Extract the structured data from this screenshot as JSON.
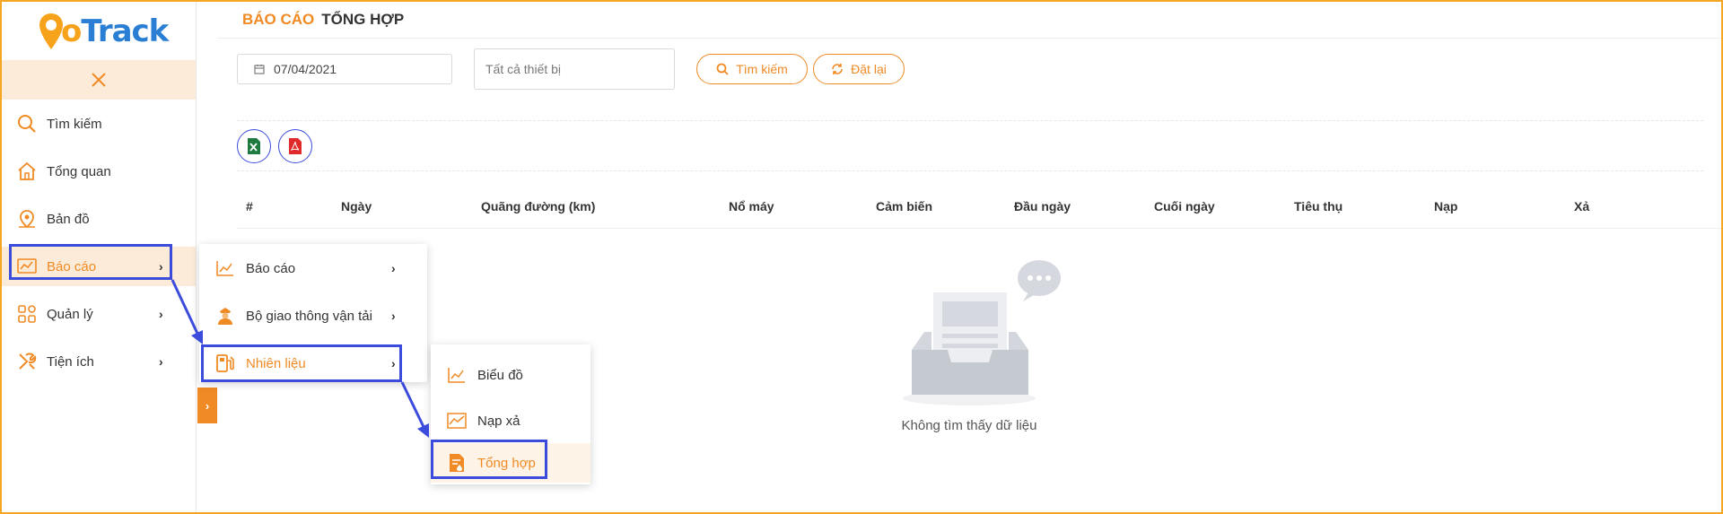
{
  "app": {
    "logo_g": "G",
    "logo_o": "o",
    "logo_rest": "Track"
  },
  "sidebar": {
    "close_icon": "close-icon",
    "items": [
      {
        "label": "Tìm kiếm",
        "icon": "search-icon"
      },
      {
        "label": "Tổng quan",
        "icon": "home-icon"
      },
      {
        "label": "Bản đồ",
        "icon": "map-pin-icon"
      },
      {
        "label": "Báo cáo",
        "icon": "chart-icon",
        "active": true
      },
      {
        "label": "Quản lý",
        "icon": "grid-icon"
      },
      {
        "label": "Tiện ích",
        "icon": "tools-icon"
      }
    ]
  },
  "breadcrumb": {
    "section": "BÁO CÁO",
    "page": "TỔNG HỢP"
  },
  "filters": {
    "date_value": "07/04/2021",
    "device_placeholder": "Tất cả thiết bị",
    "search_label": "Tìm kiếm",
    "reset_label": "Đặt lại"
  },
  "table": {
    "columns": [
      "#",
      "Ngày",
      "Quãng đường (km)",
      "Nổ máy",
      "Cảm biến",
      "Đầu ngày",
      "Cuối ngày",
      "Tiêu thụ",
      "Nạp",
      "Xả"
    ]
  },
  "empty_message": "Không tìm thấy dữ liệu",
  "submenu_1": {
    "items": [
      {
        "label": "Báo cáo",
        "icon": "line-chart-icon"
      },
      {
        "label": "Bộ giao thông vận tải",
        "icon": "officer-icon"
      },
      {
        "label": "Nhiên liệu",
        "icon": "fuel-pump-icon",
        "active": true
      }
    ]
  },
  "submenu_2": {
    "items": [
      {
        "label": "Biểu đồ",
        "icon": "line-chart-icon"
      },
      {
        "label": "Nạp xả",
        "icon": "area-chart-icon"
      },
      {
        "label": "Tổng hợp",
        "icon": "fuel-document-icon",
        "active": true
      }
    ]
  },
  "colors": {
    "accent": "#f08a24",
    "highlight": "#3b4cdd",
    "active_bg": "#fdebd9"
  }
}
